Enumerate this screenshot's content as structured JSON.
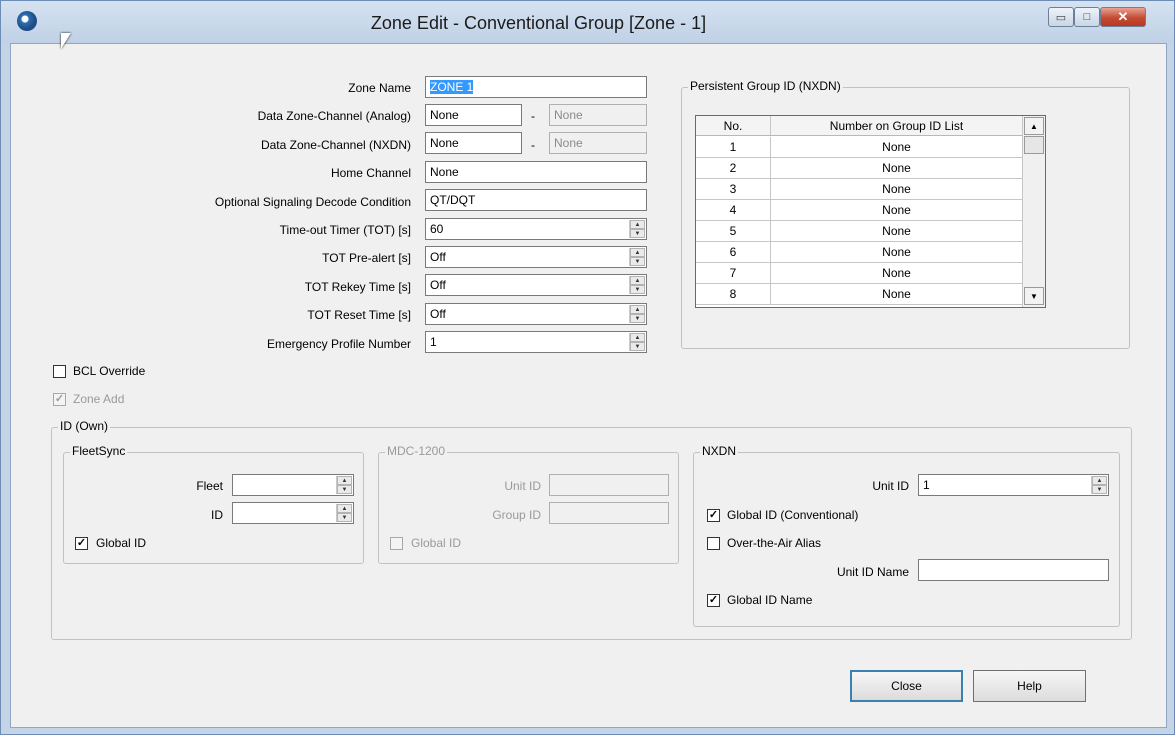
{
  "window": {
    "title": "Zone Edit - Conventional Group [Zone - 1]",
    "minimize_glyph": "▭",
    "maximize_glyph": "□",
    "close_glyph": "✕"
  },
  "form": {
    "zone_name": {
      "label": "Zone Name",
      "value": "ZONE 1"
    },
    "data_zone_analog": {
      "label": "Data Zone-Channel (Analog)",
      "value": "None",
      "sep": "-",
      "value2": "None"
    },
    "data_zone_nxdn": {
      "label": "Data Zone-Channel (NXDN)",
      "value": "None",
      "sep": "-",
      "value2": "None"
    },
    "home_channel": {
      "label": "Home Channel",
      "value": "None"
    },
    "optional_signaling": {
      "label": "Optional Signaling Decode Condition",
      "value": "QT/DQT"
    },
    "tot": {
      "label": "Time-out Timer (TOT) [s]",
      "value": "60"
    },
    "tot_prealert": {
      "label": "TOT Pre-alert [s]",
      "value": "Off"
    },
    "tot_rekey": {
      "label": "TOT Rekey Time [s]",
      "value": "Off"
    },
    "tot_reset": {
      "label": "TOT Reset Time [s]",
      "value": "Off"
    },
    "emergency_profile": {
      "label": "Emergency Profile Number",
      "value": "1"
    },
    "bcl_override": {
      "label": "BCL Override",
      "checked": false
    },
    "zone_add": {
      "label": "Zone Add",
      "checked": true,
      "enabled": false
    }
  },
  "persistent_group": {
    "title": "Persistent Group ID (NXDN)",
    "columns": [
      "No.",
      "Number on Group ID List"
    ],
    "rows": [
      {
        "no": "1",
        "value": "None"
      },
      {
        "no": "2",
        "value": "None"
      },
      {
        "no": "3",
        "value": "None"
      },
      {
        "no": "4",
        "value": "None"
      },
      {
        "no": "5",
        "value": "None"
      },
      {
        "no": "6",
        "value": "None"
      },
      {
        "no": "7",
        "value": "None"
      },
      {
        "no": "8",
        "value": "None"
      }
    ]
  },
  "id_own": {
    "title": "ID (Own)",
    "fleetsync": {
      "title": "FleetSync",
      "fleet_label": "Fleet",
      "fleet_value": "",
      "id_label": "ID",
      "id_value": "",
      "global_id_label": "Global ID",
      "global_id_checked": true
    },
    "mdc1200": {
      "title": "MDC-1200",
      "unit_id_label": "Unit ID",
      "unit_id_value": "",
      "group_id_label": "Group ID",
      "group_id_value": "",
      "global_id_label": "Global ID",
      "global_id_checked": false
    },
    "nxdn": {
      "title": "NXDN",
      "unit_id_label": "Unit ID",
      "unit_id_value": "1",
      "global_id_conv_label": "Global ID (Conventional)",
      "global_id_conv_checked": true,
      "ota_alias_label": "Over-the-Air Alias",
      "ota_alias_checked": false,
      "unit_id_name_label": "Unit ID Name",
      "unit_id_name_value": "",
      "global_id_name_label": "Global ID Name",
      "global_id_name_checked": true
    }
  },
  "buttons": {
    "close_label": "Close",
    "help_label": "Help"
  }
}
